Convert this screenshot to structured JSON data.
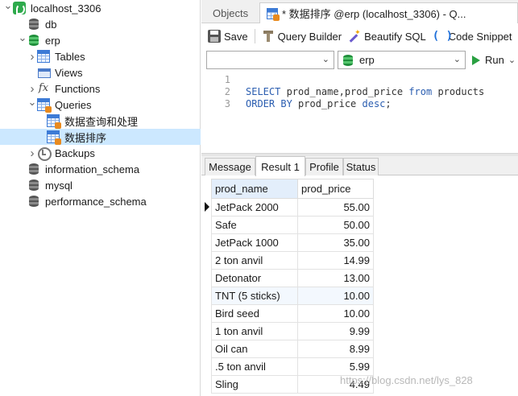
{
  "tree": [
    {
      "label": "localhost_3306",
      "icon": "connection-icon",
      "arrow": "expanded"
    },
    {
      "label": "db",
      "icon": "database-icon",
      "arrow": ""
    },
    {
      "label": "erp",
      "icon": "database-open-icon",
      "arrow": "expanded"
    },
    {
      "label": "Tables",
      "icon": "table-icon",
      "arrow": "collapsed"
    },
    {
      "label": "Views",
      "icon": "view-icon",
      "arrow": ""
    },
    {
      "label": "Functions",
      "icon": "function-icon",
      "arrow": "collapsed"
    },
    {
      "label": "Queries",
      "icon": "query-folder-icon",
      "arrow": "expanded"
    },
    {
      "label": "数据查询和处理",
      "icon": "query-icon",
      "arrow": ""
    },
    {
      "label": "数据排序",
      "icon": "query-icon",
      "arrow": "",
      "selected": true
    },
    {
      "label": "Backups",
      "icon": "backup-icon",
      "arrow": "collapsed"
    },
    {
      "label": "information_schema",
      "icon": "database-icon",
      "arrow": ""
    },
    {
      "label": "mysql",
      "icon": "database-icon",
      "arrow": ""
    },
    {
      "label": "performance_schema",
      "icon": "database-icon",
      "arrow": ""
    }
  ],
  "tabs": {
    "objects": "Objects",
    "query": "* 数据排序 @erp (localhost_3306) - Q..."
  },
  "toolbar": {
    "save": "Save",
    "query_builder": "Query Builder",
    "beautify": "Beautify SQL",
    "snippet": "Code Snippet"
  },
  "selectors": {
    "connection": "",
    "database": "erp",
    "run": "Run"
  },
  "editor": {
    "lines": [
      {
        "num": "1",
        "tokens": []
      },
      {
        "num": "2",
        "tokens": [
          {
            "t": "SELECT",
            "kw": true
          },
          {
            "t": " prod_name,prod_price ",
            "kw": false
          },
          {
            "t": "from",
            "kw": true
          },
          {
            "t": " products",
            "kw": false
          }
        ]
      },
      {
        "num": "3",
        "tokens": [
          {
            "t": "ORDER BY",
            "kw": true
          },
          {
            "t": " prod_price ",
            "kw": false
          },
          {
            "t": "desc",
            "kw": true
          },
          {
            "t": ";",
            "kw": false
          }
        ]
      }
    ]
  },
  "result_tabs": [
    "Message",
    "Result 1",
    "Profile",
    "Status"
  ],
  "active_result_tab": "Result 1",
  "grid": {
    "columns": [
      "prod_name",
      "prod_price"
    ],
    "rows": [
      [
        "JetPack 2000",
        "55.00"
      ],
      [
        "Safe",
        "50.00"
      ],
      [
        "JetPack 1000",
        "35.00"
      ],
      [
        "2 ton anvil",
        "14.99"
      ],
      [
        "Detonator",
        "13.00"
      ],
      [
        "TNT (5 sticks)",
        "10.00"
      ],
      [
        "Bird seed",
        "10.00"
      ],
      [
        "1 ton anvil",
        "9.99"
      ],
      [
        "Oil can",
        "8.99"
      ],
      [
        ".5 ton anvil",
        "5.99"
      ],
      [
        "Sling",
        "4.49"
      ]
    ]
  },
  "watermark": "https://blog.csdn.net/lys_828"
}
